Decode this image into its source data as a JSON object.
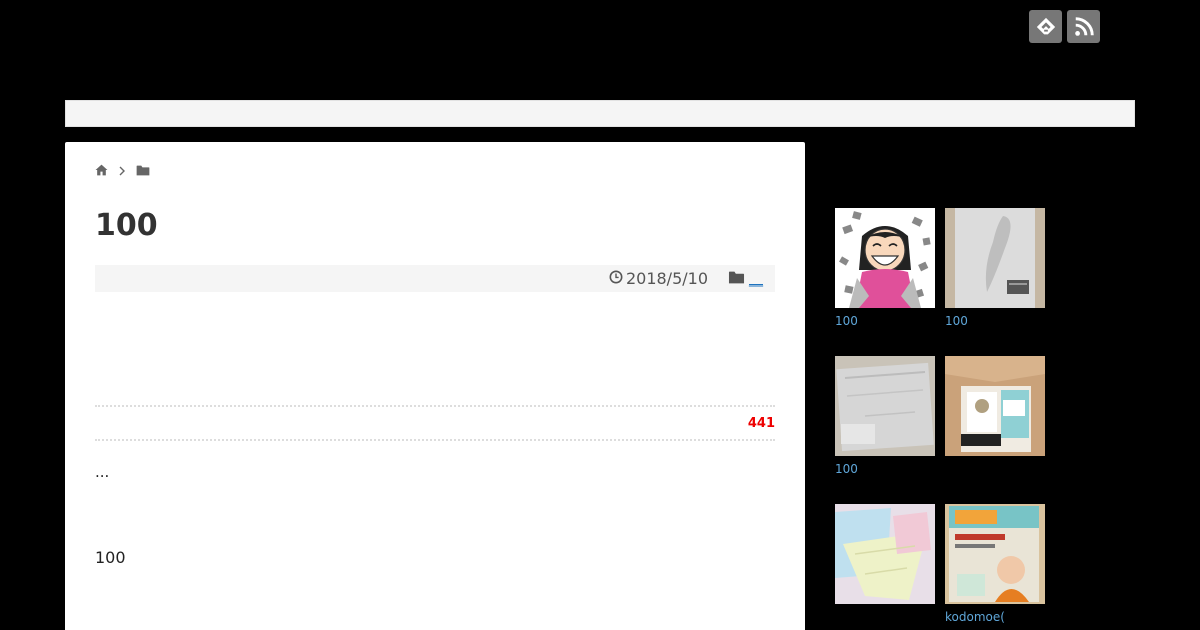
{
  "header": {
    "icons": [
      {
        "name": "feedly-icon"
      },
      {
        "name": "rss-icon"
      }
    ]
  },
  "breadcrumb": {
    "icons": [
      "home-icon",
      "chevron-right-icon",
      "folder-icon"
    ]
  },
  "post": {
    "title": "100",
    "date": "2018/5/10",
    "category_link": "__",
    "share_count": "441",
    "excerpt": "...",
    "body": "100"
  },
  "sidebar": {
    "items": [
      {
        "label": "100",
        "thumb": "cartoon-girl"
      },
      {
        "label": "100",
        "thumb": "gray-package"
      },
      {
        "label": "100",
        "thumb": "gray-cloth"
      },
      {
        "label": "",
        "thumb": "cardboard-box"
      },
      {
        "label": "",
        "thumb": "mesh-bags"
      },
      {
        "label": "kodomoe(",
        "thumb": "magazine"
      }
    ]
  },
  "colors": {
    "background": "#000000",
    "link": "#1e73be",
    "sidebar_link": "#5fa6d8",
    "share_count": "#ee0000"
  }
}
